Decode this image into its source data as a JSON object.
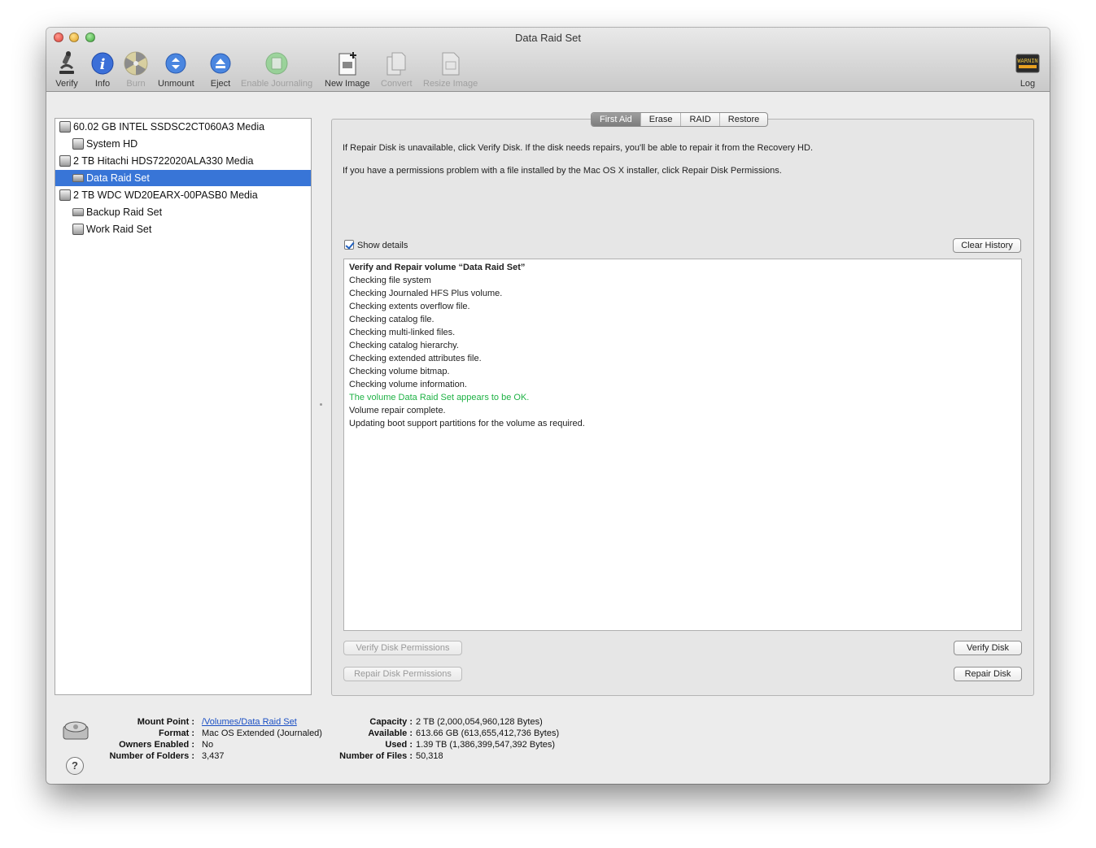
{
  "window": {
    "title": "Data Raid Set"
  },
  "toolbar": {
    "verify": "Verify",
    "info": "Info",
    "burn": "Burn",
    "unmount": "Unmount",
    "eject": "Eject",
    "enable_journaling": "Enable Journaling",
    "new_image": "New Image",
    "convert": "Convert",
    "resize_image": "Resize Image",
    "log": "Log",
    "log_icon_text": "WARNIN"
  },
  "sidebar": {
    "items": [
      {
        "label": "60.02 GB INTEL SSDSC2CT060A3 Media",
        "kind": "disk"
      },
      {
        "label": "System HD",
        "kind": "volume"
      },
      {
        "label": "2 TB Hitachi HDS722020ALA330 Media",
        "kind": "disk"
      },
      {
        "label": "Data Raid Set",
        "kind": "volume",
        "selected": true
      },
      {
        "label": "2 TB WDC WD20EARX-00PASB0 Media",
        "kind": "disk"
      },
      {
        "label": "Backup Raid Set",
        "kind": "volume"
      },
      {
        "label": "Work Raid Set",
        "kind": "volume"
      }
    ]
  },
  "tabs": [
    "First Aid",
    "Erase",
    "RAID",
    "Restore"
  ],
  "first_aid": {
    "info1": "If Repair Disk is unavailable, click Verify Disk. If the disk needs repairs, you'll be able to repair it from the Recovery HD.",
    "info2": "If you have a permissions problem with a file installed by the Mac OS X installer, click Repair Disk Permissions.",
    "show_details": "Show details",
    "clear_history": "Clear History",
    "log": [
      "Verify and Repair volume “Data Raid Set”",
      "Checking file system",
      "Checking Journaled HFS Plus volume.",
      "Checking extents overflow file.",
      "Checking catalog file.",
      "Checking multi-linked files.",
      "Checking catalog hierarchy.",
      "Checking extended attributes file.",
      "Checking volume bitmap.",
      "Checking volume information.",
      "The volume Data Raid Set appears to be OK.",
      "Volume repair complete.",
      "Updating boot support partitions for the volume as required."
    ],
    "verify_permissions": "Verify Disk Permissions",
    "repair_permissions": "Repair Disk Permissions",
    "verify_disk": "Verify Disk",
    "repair_disk": "Repair Disk"
  },
  "details": {
    "mount_point_label": "Mount Point :",
    "mount_point": "/Volumes/Data Raid Set",
    "format_label": "Format :",
    "format": "Mac OS Extended (Journaled)",
    "owners_label": "Owners Enabled :",
    "owners": "No",
    "folders_label": "Number of Folders :",
    "folders": "3,437",
    "capacity_label": "Capacity :",
    "capacity": "2 TB (2,000,054,960,128 Bytes)",
    "available_label": "Available :",
    "available": "613.66 GB (613,655,412,736 Bytes)",
    "used_label": "Used :",
    "used": "1.39 TB (1,386,399,547,392 Bytes)",
    "files_label": "Number of Files :",
    "files": "50,318"
  },
  "help": "?",
  "colors": {
    "selection": "#3875d7",
    "ok_text": "#1fb245",
    "link": "#1a4fc4"
  }
}
